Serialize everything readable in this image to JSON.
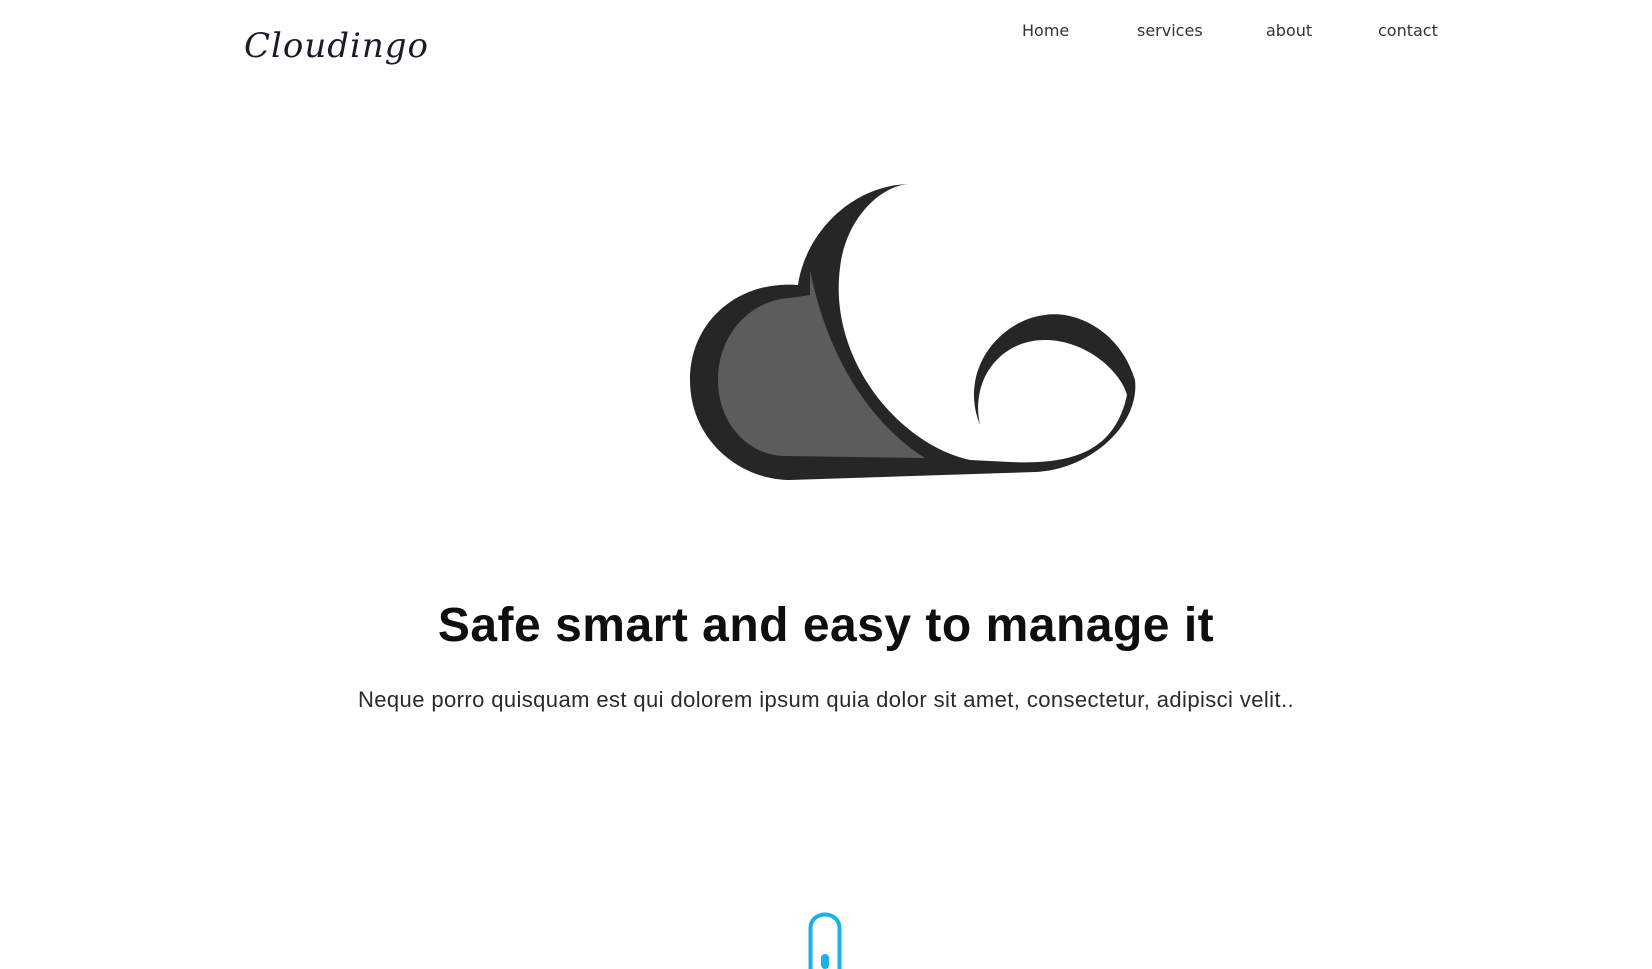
{
  "header": {
    "logo_text": "Cloudingo",
    "nav": [
      {
        "label": "Home"
      },
      {
        "label": "services"
      },
      {
        "label": "about"
      },
      {
        "label": "contact"
      }
    ]
  },
  "hero": {
    "logo_icon": "cloud-logo-icon",
    "title": "Safe smart and easy to manage it",
    "subtitle": "Neque porro quisquam est qui dolorem ipsum quia dolor sit amet, consectetur, adipisci velit.."
  },
  "scroll_indicator": {
    "icon": "mouse-scroll-icon",
    "color": "#1ab0e8"
  },
  "colors": {
    "background": "#ffffff",
    "cloud_dark": "#262626",
    "cloud_mid": "#5c5c5c",
    "accent": "#1ab0e8"
  }
}
